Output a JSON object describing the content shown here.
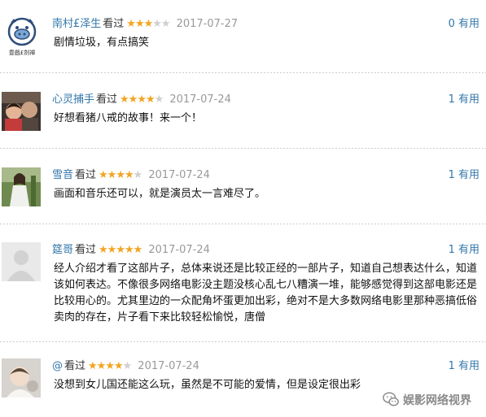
{
  "comments": [
    {
      "user": "南村£泽生",
      "watched": "看过",
      "rating": 3,
      "date": "2017-07-27",
      "useful": "0 有用",
      "text": "剧情垃圾，有点搞笑",
      "avatar_caption": "豊戲£劍禪",
      "avatar_icon": "pig-cartoon-avatar"
    },
    {
      "user": "心灵捕手",
      "watched": "看过",
      "rating": 4,
      "date": "2017-07-24",
      "useful": "1 有用",
      "text": "好想看猪八戒的故事！来一个！",
      "avatar_icon": "people-photo-avatar"
    },
    {
      "user": "雪音",
      "watched": "看过",
      "rating": 4,
      "date": "2017-07-24",
      "useful": "1 有用",
      "text": "画面和音乐还可以，就是演员太一言难尽了。",
      "avatar_icon": "person-photo-avatar"
    },
    {
      "user": "筵哥",
      "watched": "看过",
      "rating": 5,
      "date": "2017-07-24",
      "useful": "1 有用",
      "text": "经人介绍才看了这部片子，总体来说还是比较正经的一部片子，知道自己想表达什么，知道该如何表达。不像很多网络电影没主题没核心乱七八糟演一堆，能够感觉得到这部电影还是比较用心的。尤其里边的一众配角坏蛋更加出彩，绝对不是大多数网络电影里那种恶搞低俗卖肉的存在，片子看下来比较轻松愉悦，唐僧",
      "avatar_icon": "default-user-avatar"
    },
    {
      "user": "@",
      "watched": "看过",
      "rating": 4,
      "date": "2017-07-24",
      "useful": "1 有用",
      "text": "没想到女儿国还能这么玩，虽然是不可能的爱情，但是设定很出彩",
      "avatar_icon": "baby-photo-avatar"
    }
  ],
  "star_colors": {
    "on": "#f3a421",
    "off": "#cfcfcf"
  },
  "link_color": "#3377aa",
  "watermark": {
    "text": "娱影网络视界",
    "icon": "wechat-icon"
  }
}
